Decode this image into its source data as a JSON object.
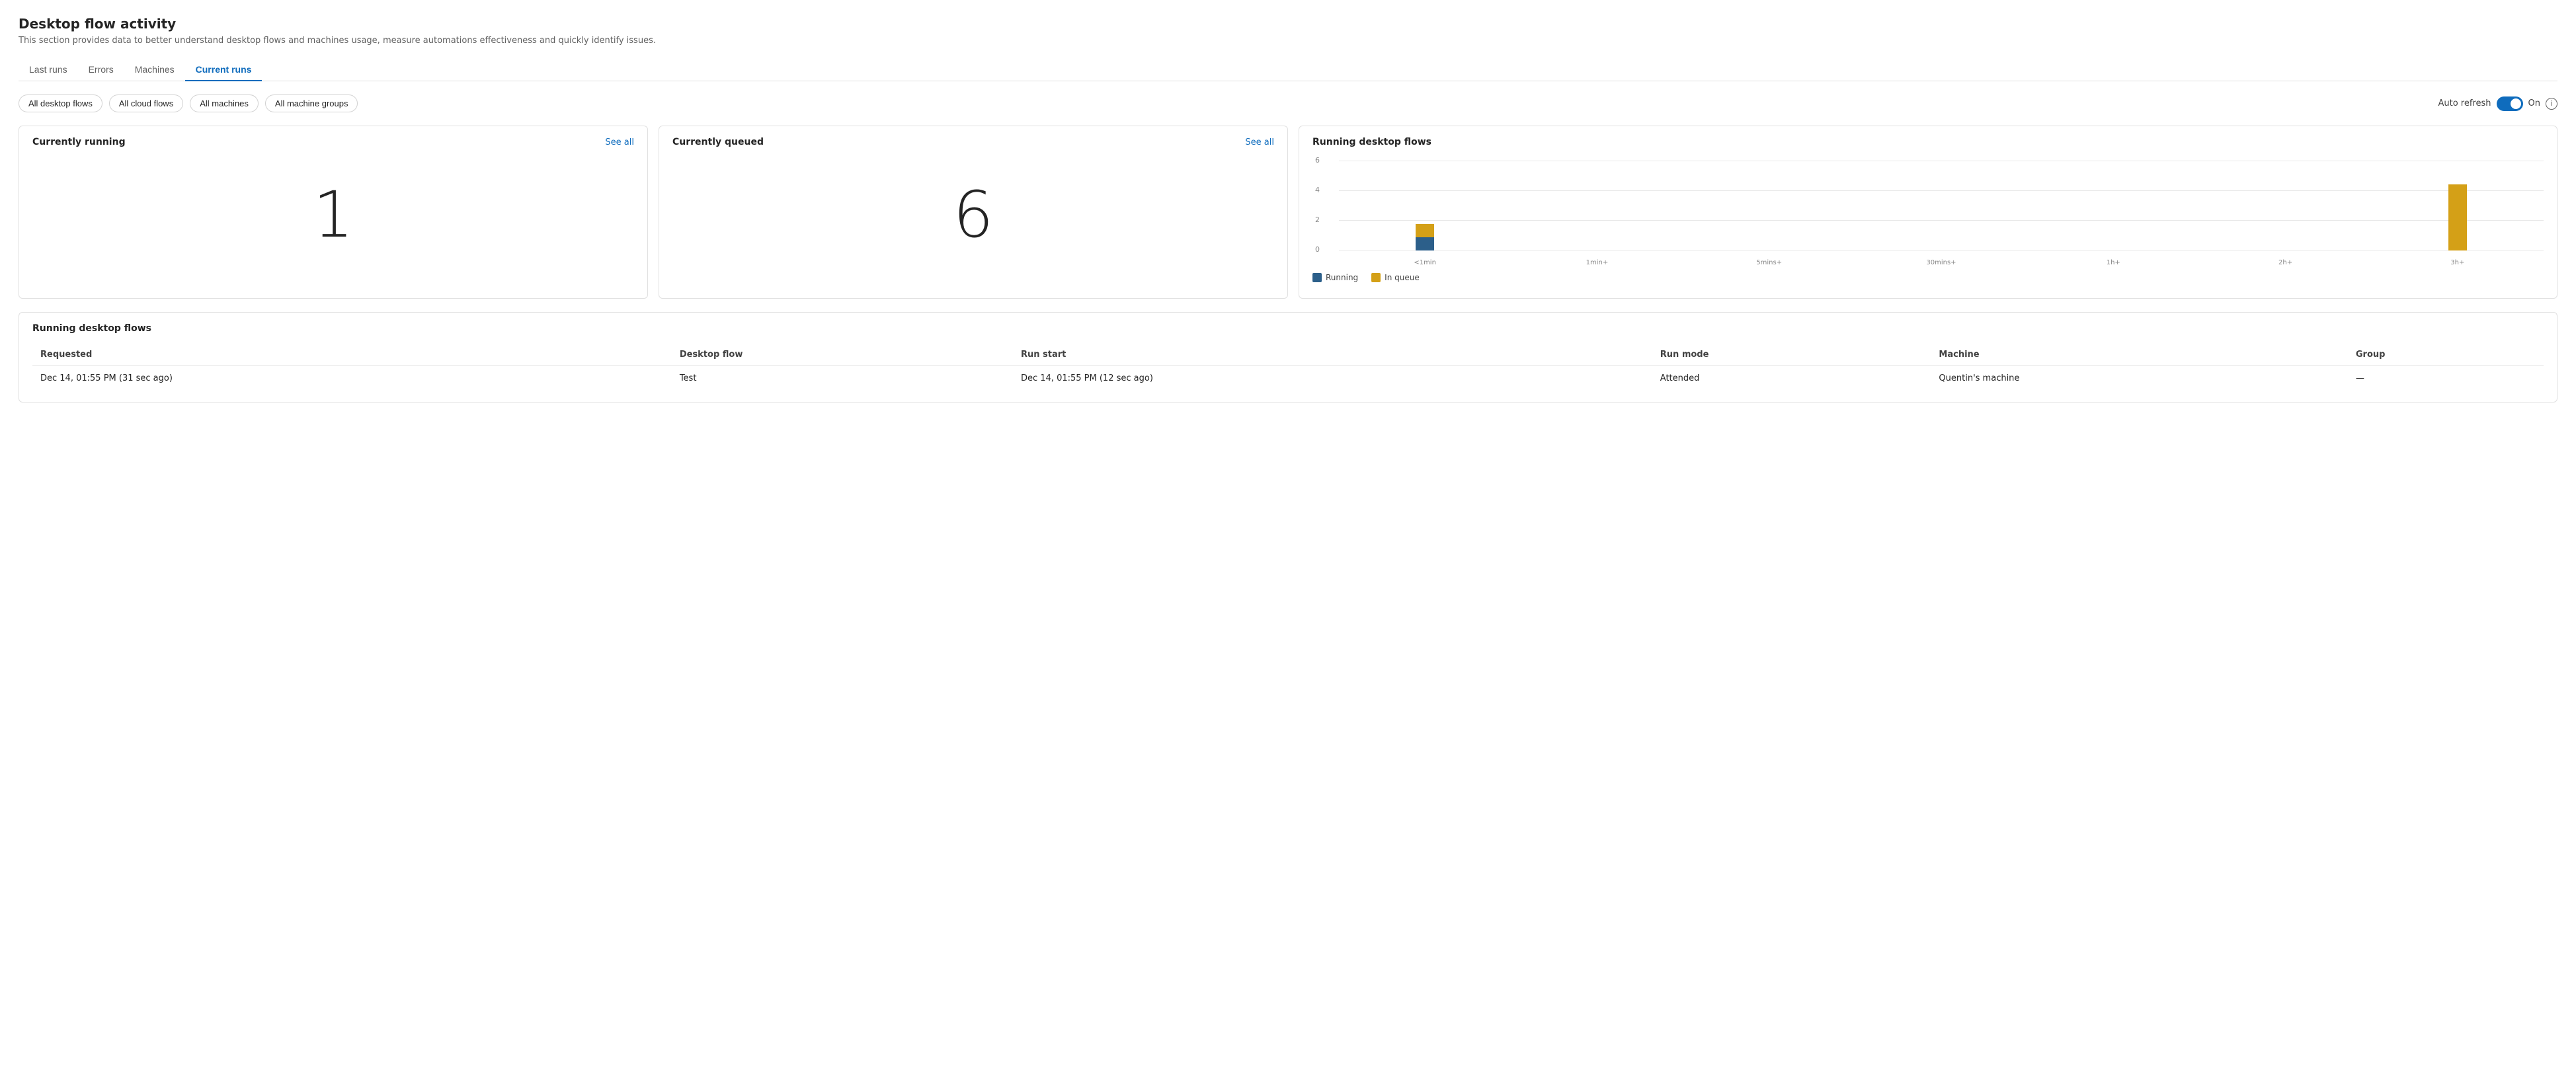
{
  "page": {
    "title": "Desktop flow activity",
    "subtitle": "This section provides data to better understand desktop flows and machines usage, measure automations effectiveness and quickly identify issues."
  },
  "tabs": [
    {
      "id": "last-runs",
      "label": "Last runs",
      "active": false
    },
    {
      "id": "errors",
      "label": "Errors",
      "active": false
    },
    {
      "id": "machines",
      "label": "Machines",
      "active": false
    },
    {
      "id": "current-runs",
      "label": "Current runs",
      "active": true
    }
  ],
  "filters": [
    {
      "id": "all-desktop-flows",
      "label": "All desktop flows"
    },
    {
      "id": "all-cloud-flows",
      "label": "All cloud flows"
    },
    {
      "id": "all-machines",
      "label": "All machines"
    },
    {
      "id": "all-machine-groups",
      "label": "All machine groups"
    }
  ],
  "autoRefresh": {
    "label": "Auto refresh",
    "status": "On"
  },
  "currentlyRunning": {
    "title": "Currently running",
    "seeAll": "See all",
    "value": "1"
  },
  "currentlyQueued": {
    "title": "Currently queued",
    "seeAll": "See all",
    "value": "6"
  },
  "chart": {
    "title": "Running desktop flows",
    "yLabels": [
      "6",
      "4",
      "2",
      "0"
    ],
    "xLabels": [
      "<1min",
      "1min+",
      "5mins+",
      "30mins+",
      "1h+",
      "2h+",
      "3h+"
    ],
    "bars": [
      {
        "running": 1,
        "queue": 1
      },
      {
        "running": 0,
        "queue": 0
      },
      {
        "running": 0,
        "queue": 0
      },
      {
        "running": 0,
        "queue": 0
      },
      {
        "running": 0,
        "queue": 0
      },
      {
        "running": 0,
        "queue": 0
      },
      {
        "running": 0,
        "queue": 5
      }
    ],
    "legend": {
      "running": "Running",
      "queue": "In queue"
    },
    "colors": {
      "running": "#2c5f8a",
      "queue": "#d4a017"
    }
  },
  "tableSection": {
    "title": "Running desktop flows",
    "columns": [
      "Requested",
      "Desktop flow",
      "Run start",
      "Run mode",
      "Machine",
      "Group"
    ],
    "rows": [
      {
        "requested": "Dec 14, 01:55 PM (31 sec ago)",
        "desktopFlow": "Test",
        "runStart": "Dec 14, 01:55 PM (12 sec ago)",
        "runMode": "Attended",
        "machine": "Quentin's machine",
        "group": "—"
      }
    ]
  }
}
